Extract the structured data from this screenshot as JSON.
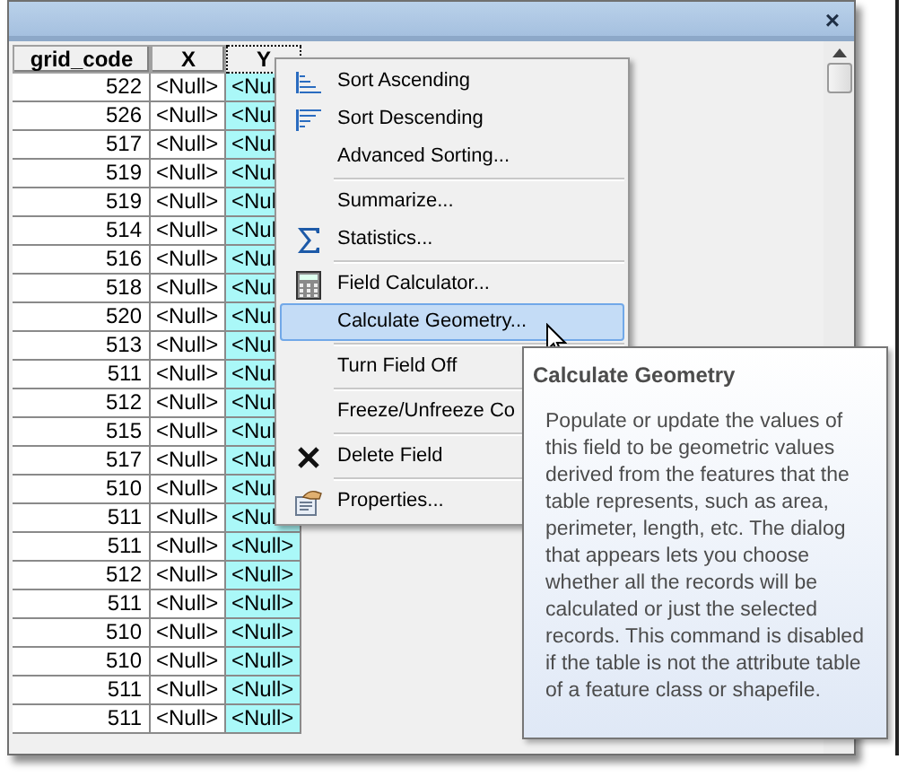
{
  "window": {
    "close_label": "×"
  },
  "table": {
    "columns": [
      {
        "label": "grid_code",
        "selected": false
      },
      {
        "label": "X",
        "selected": false
      },
      {
        "label": "Y",
        "selected": true
      }
    ],
    "rows": [
      [
        "522",
        "<Null>",
        "<Nul"
      ],
      [
        "526",
        "<Null>",
        "<Nul"
      ],
      [
        "517",
        "<Null>",
        "<Nul"
      ],
      [
        "519",
        "<Null>",
        "<Nul"
      ],
      [
        "519",
        "<Null>",
        "<Nul"
      ],
      [
        "514",
        "<Null>",
        "<Nul"
      ],
      [
        "516",
        "<Null>",
        "<Nul"
      ],
      [
        "518",
        "<Null>",
        "<Nul"
      ],
      [
        "520",
        "<Null>",
        "<Nul"
      ],
      [
        "513",
        "<Null>",
        "<Nul"
      ],
      [
        "511",
        "<Null>",
        "<Nul"
      ],
      [
        "512",
        "<Null>",
        "<Nul"
      ],
      [
        "515",
        "<Null>",
        "<Nul"
      ],
      [
        "517",
        "<Null>",
        "<Nul"
      ],
      [
        "510",
        "<Null>",
        "<Nul"
      ],
      [
        "511",
        "<Null>",
        "<Nul"
      ],
      [
        "511",
        "<Null>",
        "<Null>"
      ],
      [
        "512",
        "<Null>",
        "<Null>"
      ],
      [
        "511",
        "<Null>",
        "<Null>"
      ],
      [
        "510",
        "<Null>",
        "<Null>"
      ],
      [
        "510",
        "<Null>",
        "<Null>"
      ],
      [
        "511",
        "<Null>",
        "<Null>"
      ],
      [
        "511",
        "<Null>",
        "<Null>"
      ]
    ]
  },
  "context_menu": {
    "items": [
      {
        "kind": "item",
        "label": "Sort Ascending",
        "selected": false
      },
      {
        "kind": "item",
        "label": "Sort Descending",
        "selected": false
      },
      {
        "kind": "item",
        "label": "Advanced Sorting...",
        "selected": false
      },
      {
        "kind": "separator"
      },
      {
        "kind": "item",
        "label": "Summarize...",
        "selected": false
      },
      {
        "kind": "item",
        "label": "Statistics...",
        "selected": false
      },
      {
        "kind": "separator"
      },
      {
        "kind": "item",
        "label": "Field Calculator...",
        "selected": false
      },
      {
        "kind": "item",
        "label": "Calculate Geometry...",
        "selected": true
      },
      {
        "kind": "separator"
      },
      {
        "kind": "item",
        "label": "Turn Field Off",
        "selected": false
      },
      {
        "kind": "separator"
      },
      {
        "kind": "item",
        "label": "Freeze/Unfreeze Co",
        "selected": false
      },
      {
        "kind": "separator"
      },
      {
        "kind": "item",
        "label": "Delete Field",
        "selected": false
      },
      {
        "kind": "separator"
      },
      {
        "kind": "item",
        "label": "Properties...",
        "selected": false
      }
    ]
  },
  "tooltip": {
    "title": "Calculate Geometry",
    "text": "Populate or update the values of this field to be geometric values derived from the features that the table represents, such as area, perimeter, length, etc. The dialog that appears lets you choose whether all the records will be calculated or just the selected records. This command is disabled if the table is not the attribute table of a feature class or shapefile."
  }
}
